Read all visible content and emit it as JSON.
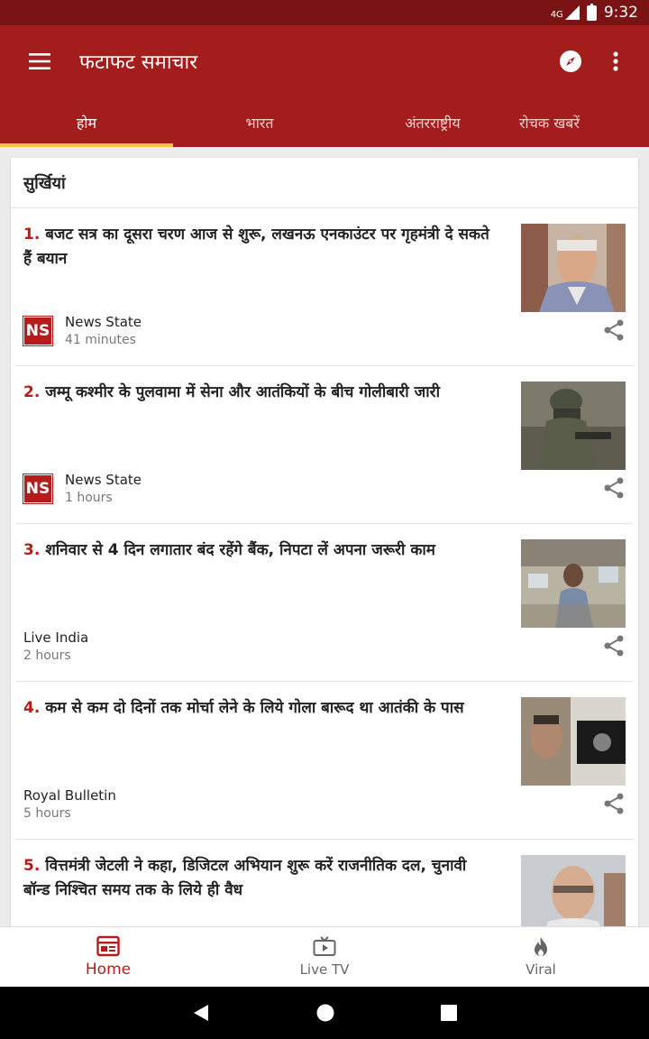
{
  "status_bar": {
    "network": "4G",
    "time": "9:32"
  },
  "app_bar": {
    "title": "फटाफट समाचार"
  },
  "tabs": [
    {
      "label": "होम",
      "active": true
    },
    {
      "label": "भारत",
      "active": false
    },
    {
      "label": "अंतरराष्ट्रीय",
      "active": false
    },
    {
      "label": "रोचक खबरें",
      "active": false
    }
  ],
  "section": {
    "title": "सुर्खियां"
  },
  "news": [
    {
      "num": "1.",
      "headline": "बजट सत्र का दूसरा चरण आज से शुरू, लखनऊ एनकाउंटर पर गृहमंत्री दे सकते हैं बयान",
      "source": "News State",
      "time": "41 minutes",
      "logo": "NS"
    },
    {
      "num": "2.",
      "headline": "जम्मू कश्मीर के पुलवामा में सेना और आतंकियों के बीच गोलीबारी जारी",
      "source": "News State",
      "time": "1 hours",
      "logo": "NS"
    },
    {
      "num": "3.",
      "headline": "शनिवार से 4 दिन लगातार बंद रहेंगे बैंक, निपटा लें अपना जरूरी काम",
      "source": "Live India",
      "time": "2 hours"
    },
    {
      "num": "4.",
      "headline": "कम से कम दो दिनों तक मोर्चा लेने के लिये गोला बारूद था आतंकी के पास",
      "source": "Royal Bulletin",
      "time": "5 hours"
    },
    {
      "num": "5.",
      "headline": "वित्तमंत्री जेटली ने कहा, डिजिटल अभियान शुरू करें राजनीतिक दल, चुनावी बॉन्ड निश्चित समय तक के लिये ही वैध"
    }
  ],
  "bottom_nav": [
    {
      "label": "Home",
      "icon": "news-icon",
      "active": true
    },
    {
      "label": "Live TV",
      "icon": "tv-icon",
      "active": false
    },
    {
      "label": "Viral",
      "icon": "flame-icon",
      "active": false
    }
  ],
  "colors": {
    "primary": "#a31d1d",
    "status_bar": "#7a1414",
    "accent": "#b71c1c",
    "tab_indicator": "#f4c542"
  }
}
